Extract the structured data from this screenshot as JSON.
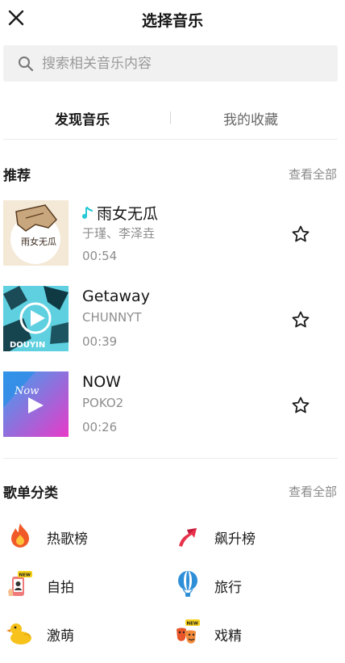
{
  "header": {
    "title": "选择音乐"
  },
  "search": {
    "placeholder": "搜索相关音乐内容"
  },
  "tabs": [
    {
      "label": "发现音乐"
    },
    {
      "label": "我的收藏"
    }
  ],
  "recommend": {
    "title": "推荐",
    "see_all": "查看全部",
    "songs": [
      {
        "title": "雨女无瓜",
        "artist": "于瑾、李泽垚",
        "duration": "00:54",
        "cover_text": "雨女无瓜"
      },
      {
        "title": "Getaway",
        "artist": "CHUNNYT",
        "duration": "00:39",
        "cover_text": "DOUYIN"
      },
      {
        "title": "NOW",
        "artist": "POKO2",
        "duration": "00:26",
        "cover_text": "Now"
      }
    ]
  },
  "categories": {
    "title": "歌单分类",
    "see_all": "查看全部",
    "items": [
      {
        "label": "热歌榜",
        "icon": "flame-icon"
      },
      {
        "label": "飙升榜",
        "icon": "trend-up-arrow-icon"
      },
      {
        "label": "自拍",
        "icon": "selfie-phone-icon",
        "badge": "NEW"
      },
      {
        "label": "旅行",
        "icon": "hot-air-balloon-icon"
      },
      {
        "label": "激萌",
        "icon": "duck-icon"
      },
      {
        "label": "戏精",
        "icon": "drama-masks-icon",
        "badge": "NEW"
      }
    ]
  },
  "colors": {
    "accent_note": "#25c8d5",
    "flame": "#f05a28",
    "balloon": "#2e8fd8",
    "duck": "#f7c21b"
  }
}
